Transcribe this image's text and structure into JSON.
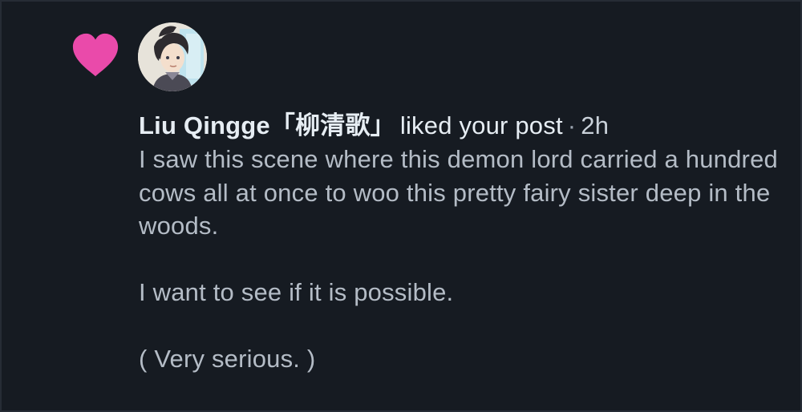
{
  "notification": {
    "type_icon": "heart-icon",
    "accent_color": "#ea4aaa",
    "avatar_icon": "user-avatar",
    "author": "Liu Qingge「柳清歌」",
    "action": "liked your post",
    "separator": "·",
    "time": "2h",
    "post_paragraphs": [
      "I saw this scene where this demon lord carried a hundred cows all at once to woo this pretty fairy sister deep in the woods.",
      "I want to see if it is possible.",
      "( Very serious. )"
    ]
  }
}
